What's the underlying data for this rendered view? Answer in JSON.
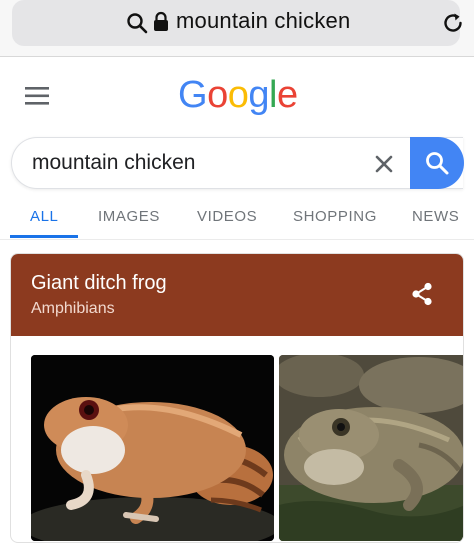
{
  "browser": {
    "url_text": "mountain chicken"
  },
  "logo": {
    "letters": [
      "G",
      "o",
      "o",
      "g",
      "l",
      "e"
    ],
    "colors": [
      "#4285f4",
      "#ea4335",
      "#fbbc05",
      "#4285f4",
      "#34a853",
      "#ea4335"
    ]
  },
  "search": {
    "value": "mountain chicken"
  },
  "tabs": [
    {
      "label": "ALL",
      "active": true
    },
    {
      "label": "IMAGES",
      "active": false
    },
    {
      "label": "VIDEOS",
      "active": false
    },
    {
      "label": "SHOPPING",
      "active": false
    },
    {
      "label": "NEWS",
      "active": false
    }
  ],
  "knowledge_card": {
    "title": "Giant ditch frog",
    "subtitle": "Amphibians",
    "header_color": "#8c3a1f"
  },
  "icons": {
    "url_search": "search-icon",
    "url_lock": "lock-icon",
    "reload": "reload-icon",
    "menu": "hamburger-menu-icon",
    "clear": "close-icon",
    "search_button": "search-icon",
    "share": "share-icon"
  },
  "colors": {
    "accent": "#1a73e8",
    "search_button": "#4285f4"
  }
}
